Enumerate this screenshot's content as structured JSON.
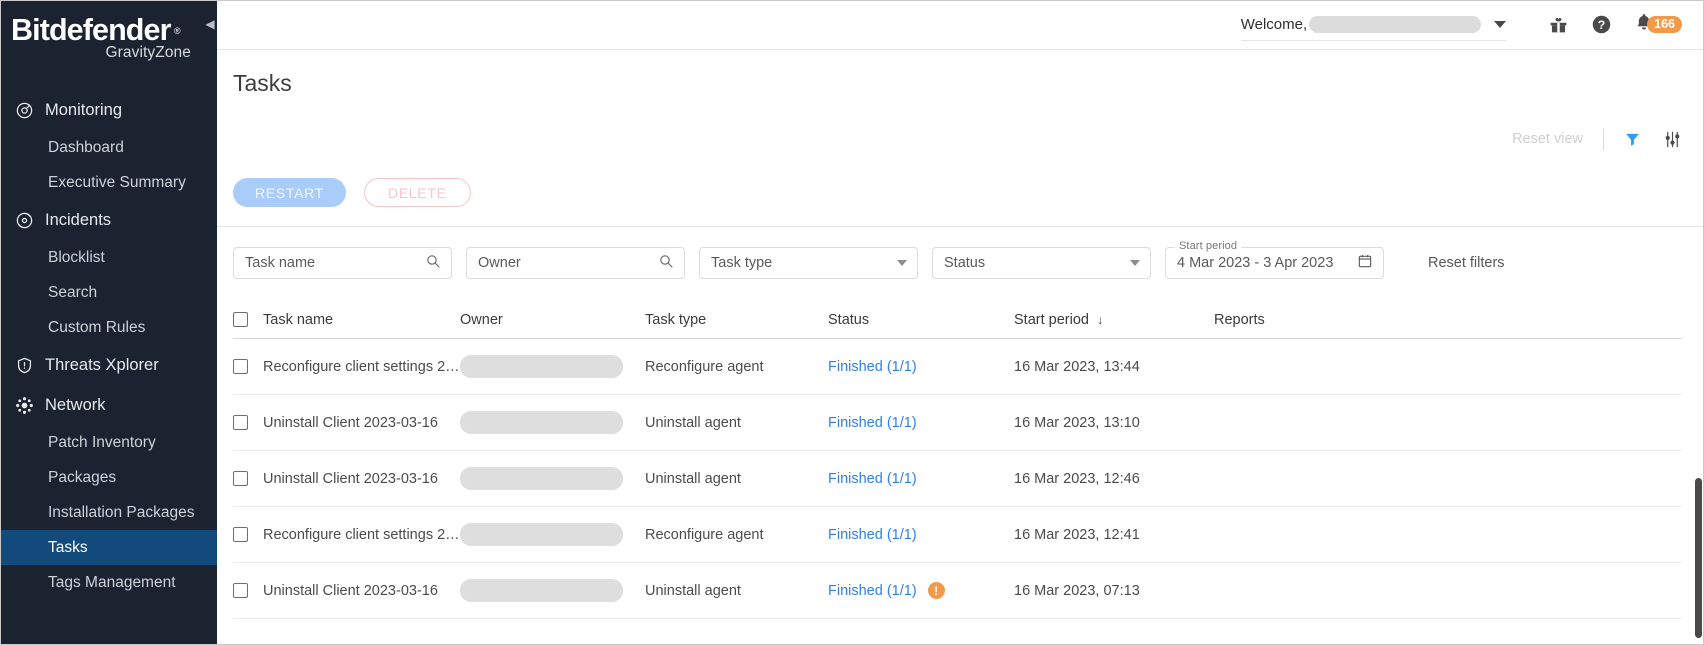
{
  "sidebar": {
    "logo": {
      "main": "Bitdefender",
      "reg": "®",
      "sub": "GravityZone"
    },
    "collapse_icon": "chevron-left-icon",
    "items": [
      {
        "label": "Monitoring",
        "type": "group",
        "icon": "monitoring-icon"
      },
      {
        "label": "Dashboard",
        "type": "child"
      },
      {
        "label": "Executive Summary",
        "type": "child"
      },
      {
        "label": "Incidents",
        "type": "group",
        "icon": "incidents-icon"
      },
      {
        "label": "Blocklist",
        "type": "child"
      },
      {
        "label": "Search",
        "type": "child"
      },
      {
        "label": "Custom Rules",
        "type": "child"
      },
      {
        "label": "Threats Xplorer",
        "type": "group",
        "icon": "shield-icon"
      },
      {
        "label": "Network",
        "type": "group",
        "icon": "network-icon"
      },
      {
        "label": "Patch Inventory",
        "type": "child"
      },
      {
        "label": "Packages",
        "type": "child"
      },
      {
        "label": "Installation Packages",
        "type": "child"
      },
      {
        "label": "Tasks",
        "type": "child",
        "active": true
      },
      {
        "label": "Tags Management",
        "type": "child"
      }
    ]
  },
  "topbar": {
    "welcome_label": "Welcome,",
    "user_redacted": "",
    "gift_icon": "gift-icon",
    "help_icon": "help-icon",
    "bell_icon": "bell-icon",
    "notification_count": "166"
  },
  "page": {
    "title": "Tasks"
  },
  "viewbar": {
    "reset_view": "Reset view",
    "filter_icon": "filter-funnel-icon",
    "columns_icon": "sliders-settings-icon",
    "filter_color": "#2f9bf2"
  },
  "actions": {
    "restart": "RESTART",
    "delete": "DELETE"
  },
  "filters": {
    "task_name_placeholder": "Task name",
    "owner_placeholder": "Owner",
    "task_type_value": "Task type",
    "status_value": "Status",
    "start_period_label": "Start period",
    "start_period_value": "4 Mar 2023 - 3 Apr 2023",
    "calendar_icon": "calendar-icon",
    "reset_filters": "Reset filters"
  },
  "table": {
    "headers": {
      "task_name": "Task name",
      "owner": "Owner",
      "task_type": "Task type",
      "status": "Status",
      "start_period": "Start period",
      "reports": "Reports"
    },
    "sort": {
      "column": "start_period",
      "direction": "desc",
      "glyph": "↓"
    },
    "rows": [
      {
        "task_name": "Reconfigure client settings 2…",
        "owner_redacted": "",
        "task_type": "Reconfigure agent",
        "status": "Finished (1/1)",
        "warning": false,
        "start_period": "16 Mar 2023, 13:44",
        "reports": ""
      },
      {
        "task_name": "Uninstall Client 2023-03-16",
        "owner_redacted": "",
        "task_type": "Uninstall agent",
        "status": "Finished (1/1)",
        "warning": false,
        "start_period": "16 Mar 2023, 13:10",
        "reports": ""
      },
      {
        "task_name": "Uninstall Client 2023-03-16",
        "owner_redacted": "",
        "task_type": "Uninstall agent",
        "status": "Finished (1/1)",
        "warning": false,
        "start_period": "16 Mar 2023, 12:46",
        "reports": ""
      },
      {
        "task_name": "Reconfigure client settings 2…",
        "owner_redacted": "",
        "task_type": "Reconfigure agent",
        "status": "Finished (1/1)",
        "warning": false,
        "start_period": "16 Mar 2023, 12:41",
        "reports": ""
      },
      {
        "task_name": "Uninstall Client 2023-03-16",
        "owner_redacted": "",
        "task_type": "Uninstall agent",
        "status": "Finished (1/1)",
        "warning": true,
        "warning_glyph": "!",
        "start_period": "16 Mar 2023, 07:13",
        "reports": ""
      }
    ]
  }
}
